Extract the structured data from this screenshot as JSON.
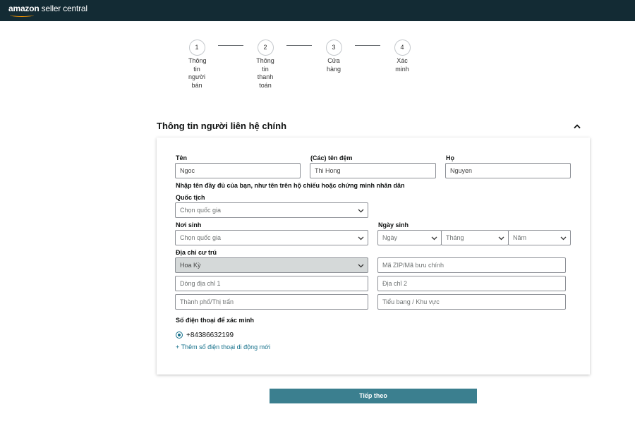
{
  "header": {
    "logo_brand": "amazon",
    "logo_suffix": "seller central",
    "bg_color": "#132b34",
    "accent": "#ff9900"
  },
  "stepper": [
    {
      "number": "1",
      "label": "Thông tin người bán"
    },
    {
      "number": "2",
      "label": "Thông tin thanh toán"
    },
    {
      "number": "3",
      "label": "Cửa hàng"
    },
    {
      "number": "4",
      "label": "Xác minh"
    }
  ],
  "section": {
    "title": "Thông tin người liên hệ chính",
    "toggle_icon": "chevron-up-icon"
  },
  "form": {
    "first_name_label": "Tên",
    "first_name_value": "Ngoc",
    "middle_name_label": "(Các) tên đệm",
    "middle_name_value": "Thi Hong",
    "last_name_label": "Họ",
    "last_name_value": "Nguyen",
    "name_note": "Nhập tên đầy đủ của bạn, như tên trên hộ chiếu hoặc chứng minh nhân dân",
    "nationality_label": "Quốc tịch",
    "nationality_value": "Chọn quốc gia",
    "birthplace_label": "Nơi sinh",
    "birthplace_value": "Chọn quốc gia",
    "dob_label": "Ngày sinh",
    "dob_day": "Ngày",
    "dob_month": "Tháng",
    "dob_year": "Năm",
    "address_label": "Địa chỉ cư trú",
    "country_value": "Hoa Kỳ",
    "zip_placeholder": "Mã ZIP/Mã bưu chính",
    "address1_placeholder": "Dòng địa chỉ 1",
    "address2_placeholder": "Địa chỉ 2",
    "city_placeholder": "Thành phố/Thị trấn",
    "state_placeholder": "Tiểu bang / Khu vực",
    "phone_label": "Số điện thoại để xác minh",
    "phone_value": "+84386632199",
    "add_phone": "+ Thêm số điện thoại di động mới"
  },
  "actions": {
    "next_label": "Tiếp theo",
    "next_color": "#3b7f8f"
  }
}
